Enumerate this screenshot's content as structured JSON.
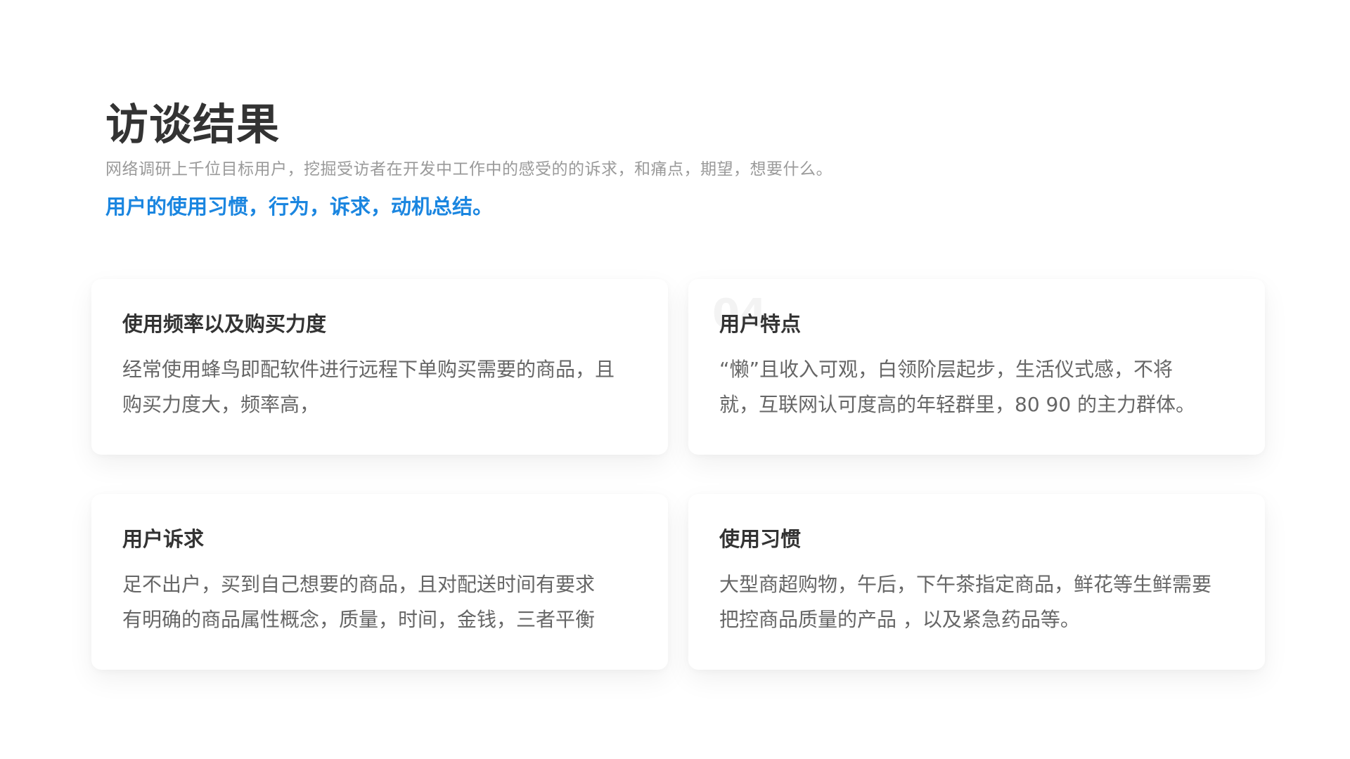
{
  "header": {
    "title": "访谈结果",
    "subtitle": "网络调研上千位目标用户，挖掘受访者在开发中工作中的感受的的诉求，和痛点，期望，想要什么。",
    "highlight": "用户的使用习惯，行为，诉求，动机总结。"
  },
  "cards": [
    {
      "title": "使用频率以及购买力度",
      "body_lines": [
        "经常使用蜂鸟即配软件进行远程下单购买需要的商品，且",
        "购买力度大，频率高，"
      ]
    },
    {
      "number": "04",
      "title": "用户特点",
      "body_lines": [
        "“懒”且收入可观，白领阶层起步，生活仪式感，不将",
        "就，互联网认可度高的年轻群里，80  90 的主力群体。"
      ]
    },
    {
      "title": "用户诉求",
      "body_lines": [
        "足不出户，买到自己想要的商品，且对配送时间有要求",
        "有明确的商品属性概念，质量，时间，金钱，三者平衡"
      ]
    },
    {
      "title": "使用习惯",
      "body_lines": [
        "大型商超购物，午后，下午茶指定商品，鲜花等生鲜需要",
        "把控商品质量的产品 ，以及紧急药品等。"
      ]
    }
  ],
  "colors": {
    "title": "#333333",
    "subtitle": "#9a9a9a",
    "accent": "#1b86e0",
    "body": "#666666",
    "card_bg": "#ffffff"
  }
}
